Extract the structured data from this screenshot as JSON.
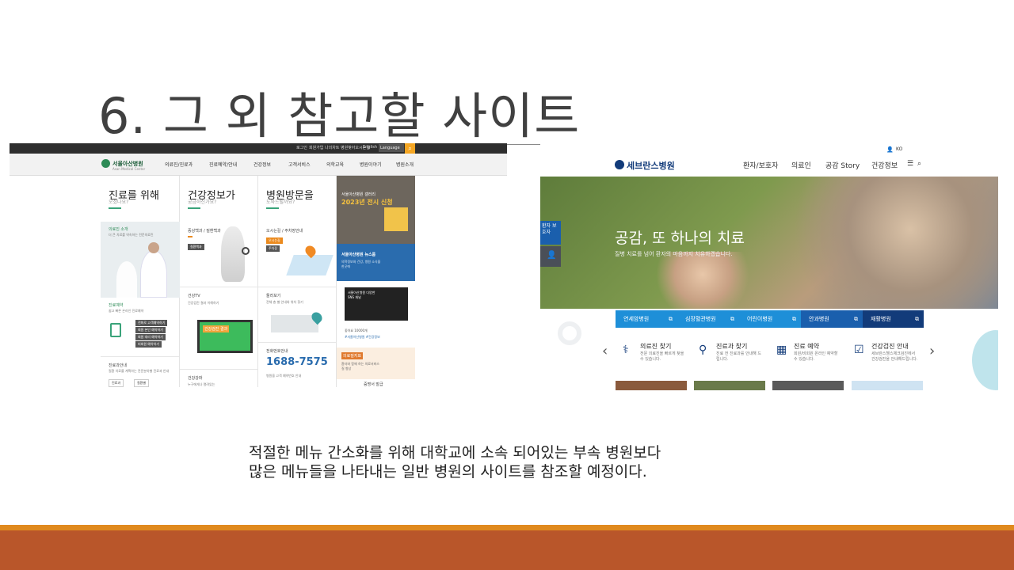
{
  "slide": {
    "title": "6. 그 외 참고할 사이트",
    "caption_line1": "적절한 메뉴 간소화를 위해 대학교에 소속 되어있는 부속 병원보다",
    "caption_line2": "많은 메뉴들을 나타내는 일반 병원의 사이트를 참조할 예정이다.",
    "colors": {
      "footer_line": "#e08a1e",
      "footer_band": "#b9562a",
      "title": "#404040"
    }
  },
  "asan": {
    "util_links": [
      "로그인",
      "회원가입",
      "나의차트",
      "병원찾아오시는길",
      "English"
    ],
    "language_label": "Language",
    "logo_name": "서울아산병원",
    "logo_sub": "Asan Medical Center",
    "nav": [
      "의료진/진료과",
      "진료예약/안내",
      "건강정보",
      "고객서비스",
      "의학교육",
      "병원이야기",
      "병원소개"
    ],
    "columns": [
      {
        "title": "진료를 위해",
        "subtitle": "오셨나요?"
      },
      {
        "title": "건강정보가",
        "subtitle": "궁금하신가요?"
      },
      {
        "title": "병원방문을",
        "subtitle": "도와드릴까요?"
      }
    ],
    "col1": {
      "doctor_intro": "의료진 소개",
      "doctor_desc": "더 큰 치료를 약속하는 전문의료진",
      "reservation": "진료예약",
      "reservation_desc": "쉽고 빠른 온라인 진료예약",
      "reserve_buttons": [
        "전화로 고객예약하기",
        "회원 본인 예약하기",
        "회원 대리 예약하기",
        "비회원 예약하기"
      ],
      "dept_guide": "진료과안내",
      "dept_desc": "질환 치료를 계획하는 전문분야별 진료과 안내",
      "dept_buttons": [
        "진료과",
        "질환별"
      ]
    },
    "col2": {
      "symptoms": "증상백과 / 질환백과",
      "symptoms_tag": "질환백과",
      "health_tv": "건강TV",
      "health_tv_desc": "건강검진 결과 이해하기",
      "tv_screen_text": "건강검진 결과",
      "lecture": "건강강좌",
      "lecture_desc": "누구에게나 열려있는"
    },
    "col3": {
      "directions": "오시는길 / 주차장안내",
      "directions_tags": [
        "오시는길",
        "주차장"
      ],
      "floor_map": "둘러보기",
      "floor_map_desc": "전체 층 별 안내와 위치 찾기",
      "phone_guide": "전화번호안내",
      "phone": "1688-7575",
      "phone_tag": "병원을 고객 예약번호 안내"
    },
    "col4": {
      "gallery_title": "서울아산병원 갤러리",
      "gallery_event": "2023년 전시 신청",
      "news_title": "서울아산병원 뉴스룸",
      "news_desc": "의학정보와 건강, 병원 소식을 한곳에",
      "sns_caption": "서울아산병원 다양한 SNS 채널",
      "likes": "좋아요 10000개",
      "tags": "#서울아산병원 #건강정보",
      "card_title": "의료질지표",
      "card_desc": "환자와 함께 하는 의료서비스 질 향상",
      "cert": "증명서 발급"
    },
    "colors": {
      "topbar": "#2e2e2e",
      "accent": "#3aa37a",
      "search": "#f5a623",
      "news": "#2a6cae"
    }
  },
  "sev": {
    "logo": "세브란스병원",
    "lang": "KO",
    "menu": [
      "환자/보호자",
      "의료인",
      "공감 Story",
      "건강정보"
    ],
    "side_tab": "환자 보호자",
    "hero_title": "공감, 또 하나의 치료",
    "hero_sub": "질병 치료를 넘어 환자의 마음까지 치유하겠습니다.",
    "hospitals": [
      {
        "name": "연세암병원",
        "color": "#1e8fd8"
      },
      {
        "name": "심장혈관병원",
        "color": "#1e8fd8"
      },
      {
        "name": "어린이병원",
        "color": "#1e8fd8"
      },
      {
        "name": "안과병원",
        "color": "#1a5fad"
      },
      {
        "name": "재활병원",
        "color": "#123b7a"
      }
    ],
    "quick_links": [
      {
        "title": "의료진 찾기",
        "desc": "전문 의료진을 빠르게 찾을 수 있습니다."
      },
      {
        "title": "진료과 찾기",
        "desc": "진료 전 진료과를 안내해 드립니다."
      },
      {
        "title": "진료 예약",
        "desc": "회원/비회원 온라인 예약할 수 있습니다."
      },
      {
        "title": "건강검진 안내",
        "desc": "세브란스헬스체크검진에서 건강검진을 안내해드립니다."
      }
    ],
    "colors": {
      "brand": "#123b7a",
      "tab": "#1a5fad"
    }
  }
}
